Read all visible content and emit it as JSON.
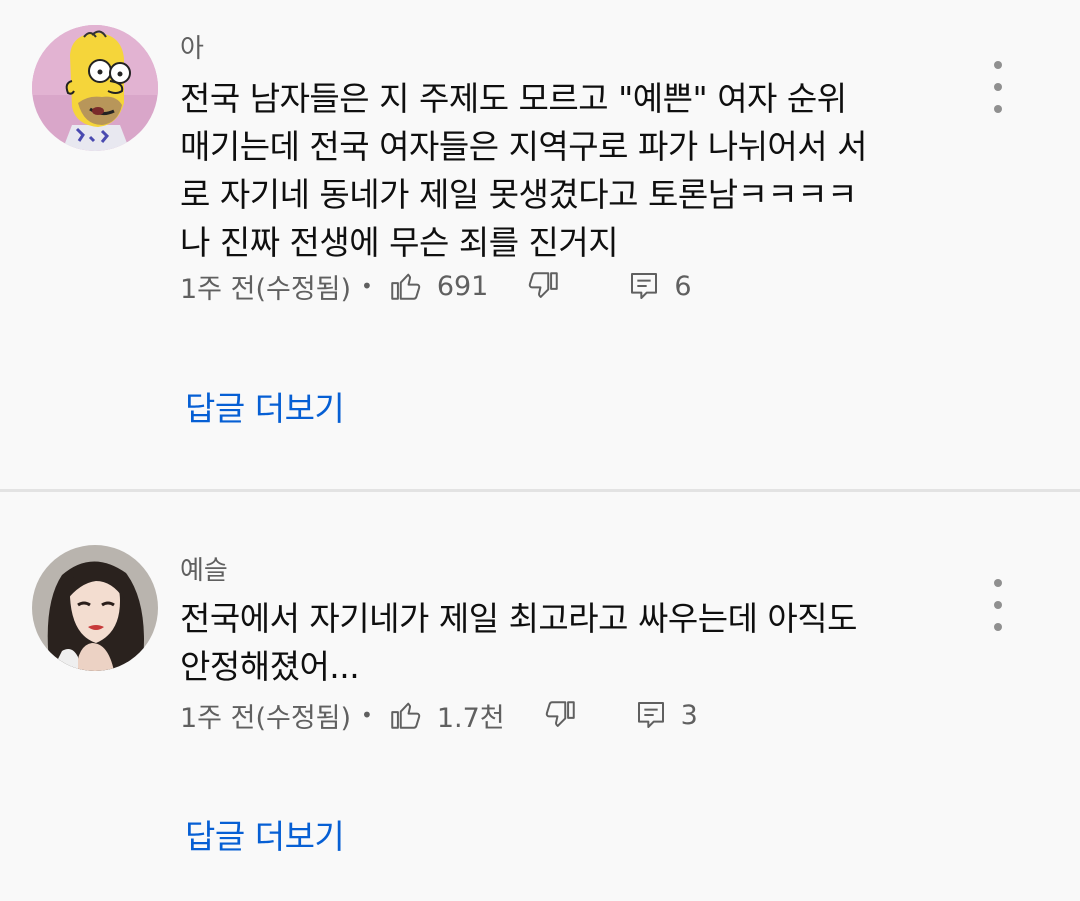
{
  "comments": [
    {
      "author": "아",
      "text_lines": [
        "전국 남자들은 지 주제도 모르고 \"예쁜\" 여자 순위",
        "매기는데 전국 여자들은 지역구로 파가 나뉘어서 서",
        "로 자기네 동네가 제일 못생겼다고 토론남ㅋㅋㅋㅋ",
        "나 진짜 전생에 무슨 죄를 진거지"
      ],
      "time": "1주 전(수정됨)",
      "likes": "691",
      "replies": "6",
      "more_replies": "답글 더보기",
      "avatar_icon": "homer-avatar-icon"
    },
    {
      "author": "예슬",
      "text_lines": [
        "전국에서 자기네가 제일 최고라고 싸우는데 아직도",
        "안정해졌어..."
      ],
      "time": "1주 전(수정됨)",
      "likes": "1.7천",
      "replies": "3",
      "more_replies": "답글 더보기",
      "avatar_icon": "woman-avatar-icon"
    }
  ],
  "meta_separator": "•",
  "colors": {
    "background": "#f9f9f9",
    "link": "#065fd4",
    "secondary_text": "#606060",
    "divider": "#e3e3e3"
  }
}
